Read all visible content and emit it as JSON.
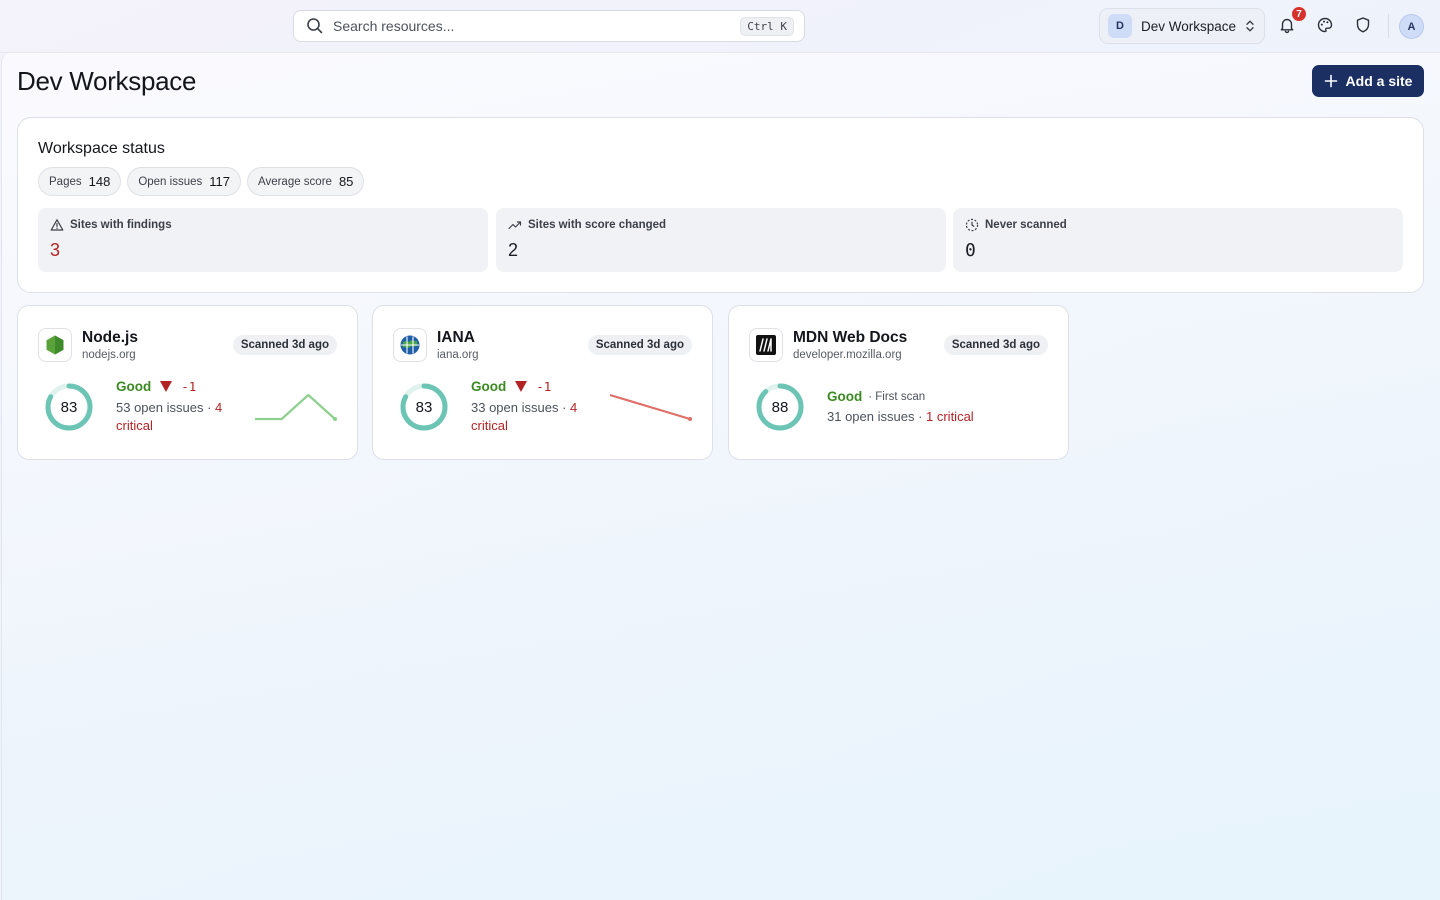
{
  "topbar": {
    "search_placeholder": "Search resources...",
    "search_shortcut": "Ctrl K",
    "workspace_initial": "D",
    "workspace_name": "Dev Workspace",
    "notification_count": "7",
    "user_initial": "A"
  },
  "page": {
    "title": "Dev Workspace",
    "add_site_label": "Add a site"
  },
  "status": {
    "title": "Workspace status",
    "pills": [
      {
        "label": "Pages",
        "value": "148"
      },
      {
        "label": "Open issues",
        "value": "117"
      },
      {
        "label": "Average score",
        "value": "85"
      }
    ],
    "stats": [
      {
        "label": "Sites with findings",
        "value": "3",
        "icon": "warning-icon"
      },
      {
        "label": "Sites with score changed",
        "value": "2",
        "icon": "trending-icon"
      },
      {
        "label": "Never scanned",
        "value": "0",
        "icon": "dashed-clock-icon"
      }
    ]
  },
  "sites": [
    {
      "name": "Node.js",
      "domain": "nodejs.org",
      "scanned": "Scanned 3d ago",
      "score": 83,
      "rating": "Good",
      "delta": "-1",
      "issues_text": "53 open issues · ",
      "critical_text": "4 critical",
      "trend": [
        83,
        83,
        84,
        83
      ],
      "trend_color": "#8fcf8f",
      "favicon": "nodejs-hexagon-icon"
    },
    {
      "name": "IANA",
      "domain": "iana.org",
      "scanned": "Scanned 3d ago",
      "score": 83,
      "rating": "Good",
      "delta": "-1",
      "issues_text": "33 open issues · ",
      "critical_text": "4 critical",
      "trend": [
        84,
        83
      ],
      "trend_color": "#e0706a",
      "favicon": "iana-globe-icon"
    },
    {
      "name": "MDN Web Docs",
      "domain": "developer.mozilla.org",
      "scanned": "Scanned 3d ago",
      "score": 88,
      "rating": "Good",
      "first_scan": "· First scan",
      "issues_text": "31 open issues · ",
      "critical_text": "1 critical",
      "favicon": "mdn-logo-icon"
    }
  ],
  "colors": {
    "accent": "#1b2f63",
    "good": "#3c8a22",
    "critical": "#b42323",
    "gauge": "#6cc4b5"
  }
}
